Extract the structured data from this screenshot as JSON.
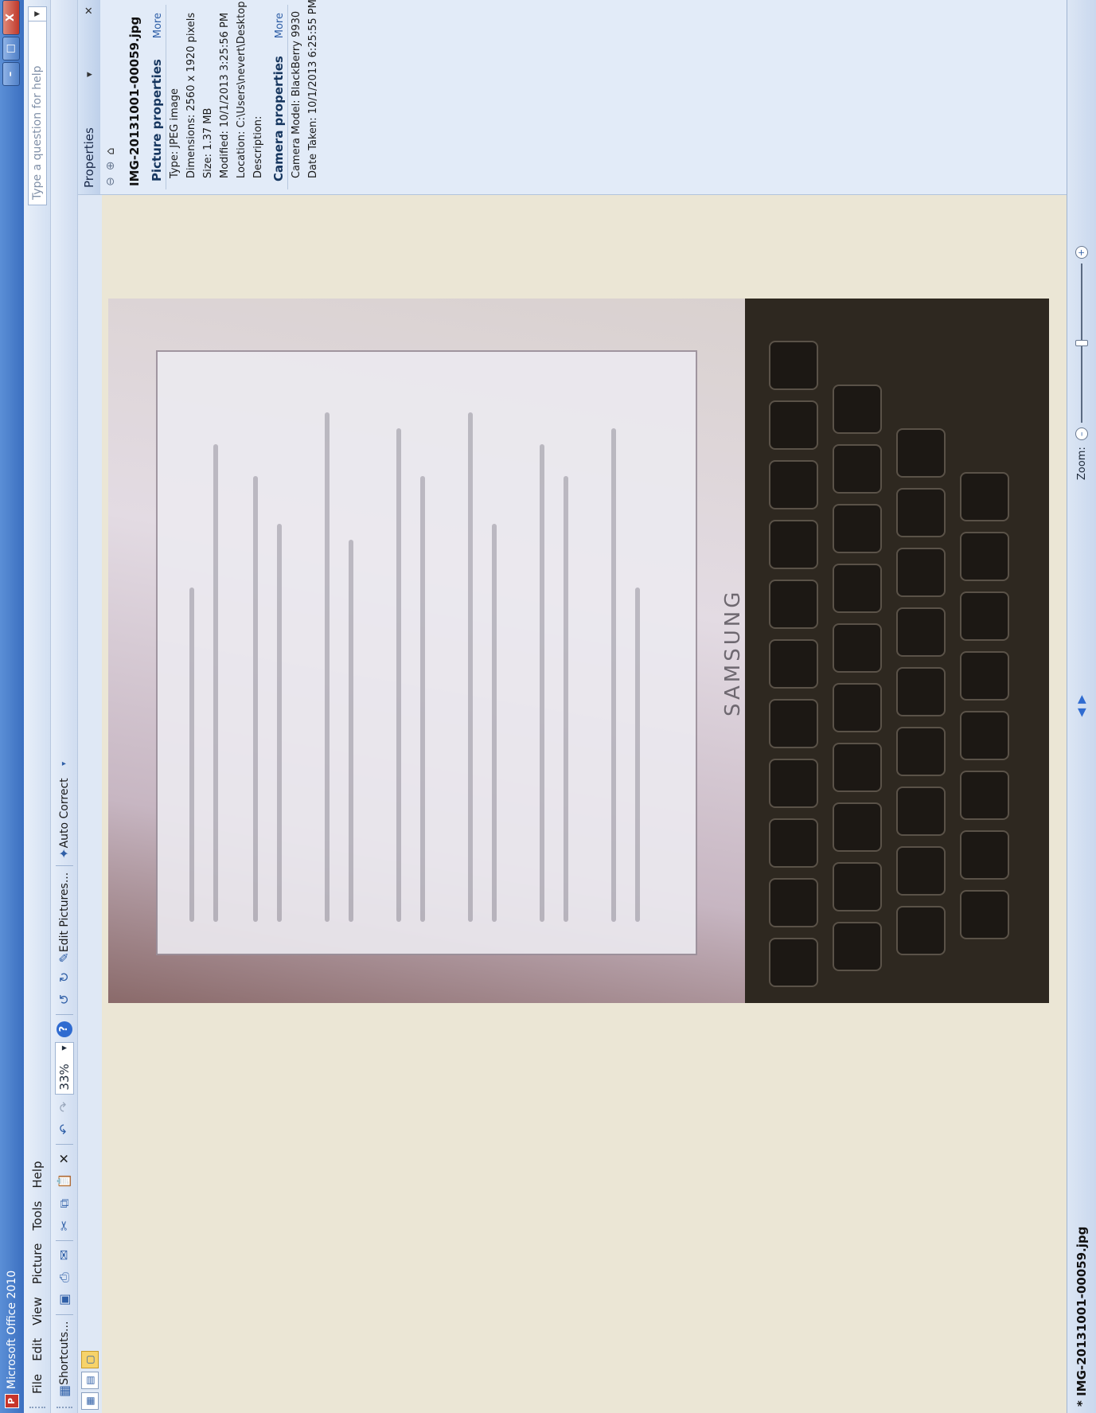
{
  "window": {
    "title": "Microsoft Office 2010",
    "minimize": "–",
    "maximize": "□",
    "close": "X"
  },
  "menu": {
    "items": [
      "File",
      "Edit",
      "View",
      "Picture",
      "Tools",
      "Help"
    ],
    "help_placeholder": "Type a question for help"
  },
  "toolbar": {
    "shortcuts_label": "Shortcuts...",
    "zoom_value": "33%",
    "edit_pictures_label": "Edit Pictures...",
    "auto_correct_label": "Auto Correct"
  },
  "properties": {
    "header": "Properties",
    "file_name": "IMG-20131001-00059.jpg",
    "picture_section": "Picture properties",
    "more": "More",
    "type": "Type: JPEG image",
    "dimensions": "Dimensions: 2560 x 1920 pixels",
    "size": "Size: 1.37 MB",
    "modified": "Modified: 10/1/2013 3:25:56 PM",
    "location": "Location:   C:\\Users\\nevert\\Desktop",
    "description": "Description:",
    "camera_section": "Camera properties",
    "camera_model": "Camera Model: BlackBerry 9930",
    "date_taken": "Date Taken: 10/1/2013 6:25:55 PM"
  },
  "status": {
    "file_label": "* IMG-20131001-00059.jpg",
    "zoom_label": "Zoom:",
    "zoom_level": 0.5
  },
  "photo": {
    "brand_text": "SAMSUNG"
  }
}
